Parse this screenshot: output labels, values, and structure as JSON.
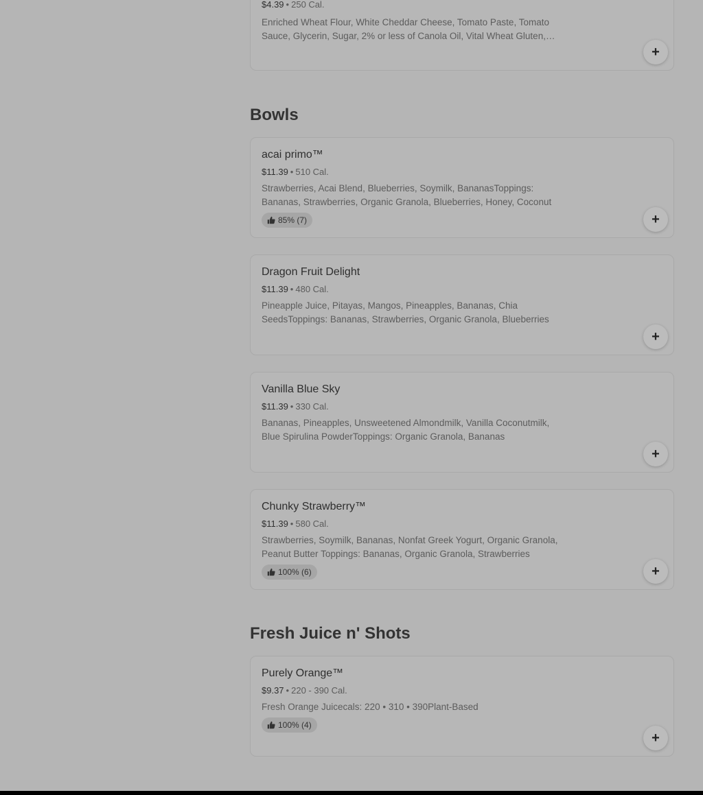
{
  "top_item": {
    "price": "$4.39",
    "calories": "250 Cal.",
    "description": "Enriched Wheat Flour, White Cheddar Cheese, Tomato Paste, Tomato Sauce, Glycerin, Sugar, 2% or less of Canola Oil, Vital Wheat Gluten, Water"
  },
  "sections": {
    "bowls": {
      "title": "Bowls",
      "items": [
        {
          "name": "acai primo™",
          "price": "$11.39",
          "calories": "510 Cal.",
          "description": "Strawberries, Acai Blend, Blueberries, Soymilk, BananasToppings: Bananas, Strawberries, Organic Granola, Blueberries, Honey, Coconut",
          "rating": "85% (7)"
        },
        {
          "name": "Dragon Fruit Delight",
          "price": "$11.39",
          "calories": "480 Cal.",
          "description": "Pineapple Juice, Pitayas, Mangos, Pineapples, Bananas, Chia SeedsToppings: Bananas, Strawberries, Organic Granola, Blueberries"
        },
        {
          "name": "Vanilla Blue Sky",
          "price": "$11.39",
          "calories": "330 Cal.",
          "description": "Bananas, Pineapples, Unsweetened Almondmilk, Vanilla Coconutmilk, Blue Spirulina PowderToppings: Organic Granola, Bananas"
        },
        {
          "name": "Chunky Strawberry™",
          "price": "$11.39",
          "calories": "580 Cal.",
          "description": "Strawberries, Soymilk, Bananas, Nonfat Greek Yogurt, Organic Granola, Peanut Butter Toppings: Bananas, Organic Granola, Strawberries",
          "rating": "100% (6)"
        }
      ]
    },
    "juice": {
      "title": "Fresh Juice n' Shots",
      "items": [
        {
          "name": "Purely Orange™",
          "price": "$9.37",
          "calories": "220 - 390 Cal.",
          "description": "Fresh Orange Juicecals: 220 • 310 • 390Plant-Based",
          "rating": "100% (4)"
        }
      ]
    }
  },
  "separator": "•",
  "add_icon": "plus-icon",
  "rating_icon": "thumbs-up-icon",
  "colors": {
    "background": "#b5b5b5",
    "card_border": "#a9a9a9",
    "footer": "#000000"
  }
}
